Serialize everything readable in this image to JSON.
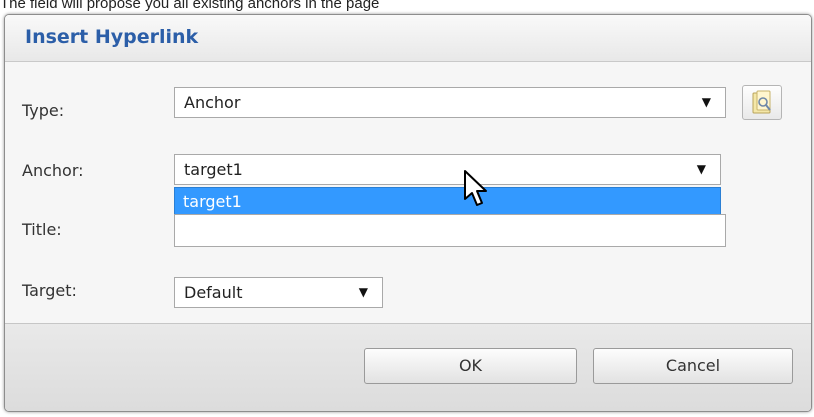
{
  "caption": "The field will propose you all existing anchors in the page",
  "dialog": {
    "title": "Insert Hyperlink",
    "type": {
      "label": "Type:",
      "value": "Anchor"
    },
    "anchor": {
      "label": "Anchor:",
      "value": "target1",
      "options": [
        "target1"
      ]
    },
    "title_field": {
      "label": "Title:",
      "value": ""
    },
    "target": {
      "label": "Target:",
      "value": "Default"
    },
    "ok_label": "OK",
    "cancel_label": "Cancel"
  },
  "icons": {
    "dropdown_arrow": "▼",
    "browse": "folder-search-icon",
    "cursor": "mouse-pointer-icon"
  },
  "colors": {
    "title": "#2b5ea8",
    "selection": "#3399ff"
  }
}
